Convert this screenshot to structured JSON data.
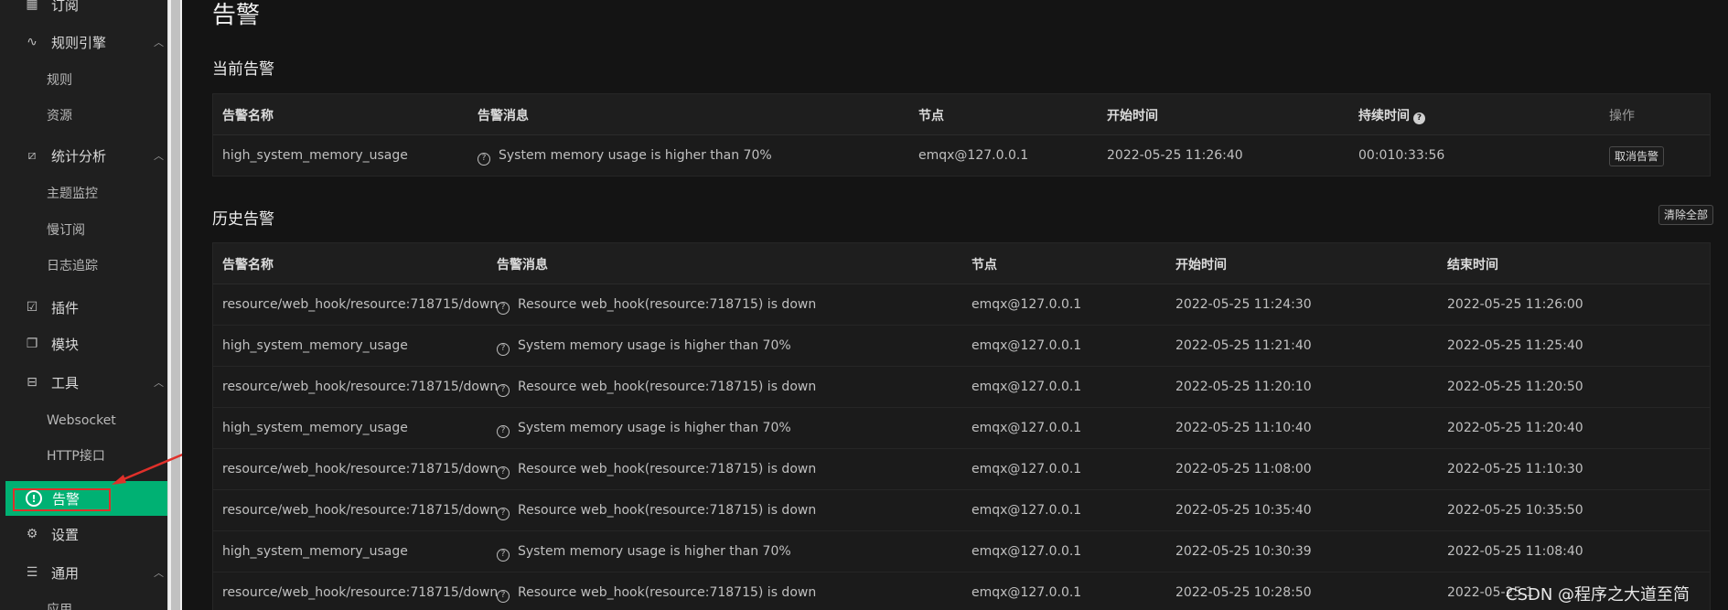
{
  "sidebar": {
    "top_partial_label": "订阅",
    "groups": {
      "rules": {
        "label": "规则引擎",
        "items": [
          "规则",
          "资源"
        ]
      },
      "stats": {
        "label": "统计分析",
        "items": [
          "主题监控",
          "慢订阅",
          "日志追踪"
        ]
      },
      "plugins": {
        "label": "插件"
      },
      "modules": {
        "label": "模块"
      },
      "tools": {
        "label": "工具",
        "items": [
          "Websocket",
          "HTTP接口"
        ]
      },
      "alarms": {
        "label": "告警"
      },
      "settings": {
        "label": "设置"
      },
      "general": {
        "label": "通用",
        "items": [
          "应用"
        ]
      }
    },
    "active_color": "#00b173"
  },
  "page": {
    "title": "告警",
    "current": {
      "title": "当前告警",
      "columns": [
        "告警名称",
        "告警消息",
        "节点",
        "开始时间",
        "持续时间",
        "操作"
      ],
      "rows": [
        {
          "name": "high_system_memory_usage",
          "message": "System memory usage is higher than 70%",
          "node": "emqx@127.0.0.1",
          "start": "2022-05-25 11:26:40",
          "duration": "00:010:33:56",
          "action_label": "取消告警"
        }
      ]
    },
    "history": {
      "title": "历史告警",
      "clear_label": "清除全部",
      "columns": [
        "告警名称",
        "告警消息",
        "节点",
        "开始时间",
        "结束时间"
      ],
      "rows": [
        {
          "name": "resource/web_hook/resource:718715/down",
          "message": "Resource web_hook(resource:718715) is down",
          "node": "emqx@127.0.0.1",
          "start": "2022-05-25 11:24:30",
          "end": "2022-05-25 11:26:00"
        },
        {
          "name": "high_system_memory_usage",
          "message": "System memory usage is higher than 70%",
          "node": "emqx@127.0.0.1",
          "start": "2022-05-25 11:21:40",
          "end": "2022-05-25 11:25:40"
        },
        {
          "name": "resource/web_hook/resource:718715/down",
          "message": "Resource web_hook(resource:718715) is down",
          "node": "emqx@127.0.0.1",
          "start": "2022-05-25 11:20:10",
          "end": "2022-05-25 11:20:50"
        },
        {
          "name": "high_system_memory_usage",
          "message": "System memory usage is higher than 70%",
          "node": "emqx@127.0.0.1",
          "start": "2022-05-25 11:10:40",
          "end": "2022-05-25 11:20:40"
        },
        {
          "name": "resource/web_hook/resource:718715/down",
          "message": "Resource web_hook(resource:718715) is down",
          "node": "emqx@127.0.0.1",
          "start": "2022-05-25 11:08:00",
          "end": "2022-05-25 11:10:30"
        },
        {
          "name": "resource/web_hook/resource:718715/down",
          "message": "Resource web_hook(resource:718715) is down",
          "node": "emqx@127.0.0.1",
          "start": "2022-05-25 10:35:40",
          "end": "2022-05-25 10:35:50"
        },
        {
          "name": "high_system_memory_usage",
          "message": "System memory usage is higher than 70%",
          "node": "emqx@127.0.0.1",
          "start": "2022-05-25 10:30:39",
          "end": "2022-05-25 11:08:40"
        },
        {
          "name": "resource/web_hook/resource:718715/down",
          "message": "Resource web_hook(resource:718715) is down",
          "node": "emqx@127.0.0.1",
          "start": "2022-05-25 10:28:50",
          "end": "2022-05-25 1"
        }
      ]
    }
  },
  "watermark": "CSDN @程序之大道至简"
}
